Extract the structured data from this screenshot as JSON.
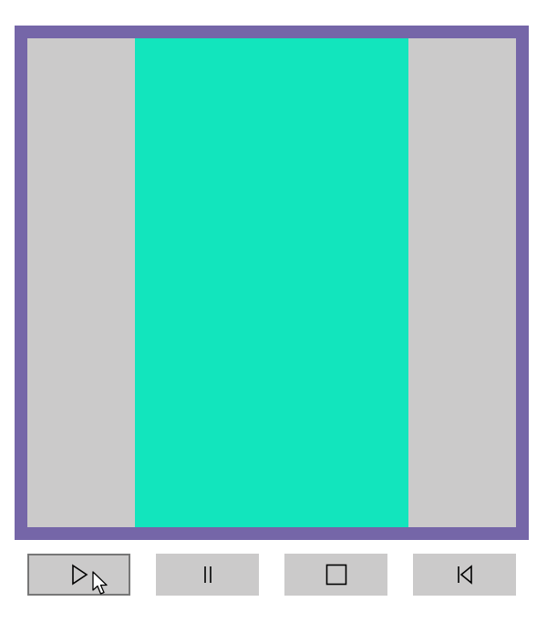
{
  "stage": {
    "frame_color": "#7566a8",
    "background_color": "#cbcaca",
    "bar_color": "#12e5bd"
  },
  "controls": {
    "button_color": "#cbcaca",
    "active_border_color": "#777777",
    "buttons": [
      {
        "name": "play",
        "icon": "play-icon",
        "active": true
      },
      {
        "name": "pause",
        "icon": "pause-icon",
        "active": false
      },
      {
        "name": "stop",
        "icon": "stop-icon",
        "active": false
      },
      {
        "name": "rewind",
        "icon": "skip-back-icon",
        "active": false
      }
    ]
  },
  "cursor": {
    "icon": "mouse-pointer-icon"
  }
}
